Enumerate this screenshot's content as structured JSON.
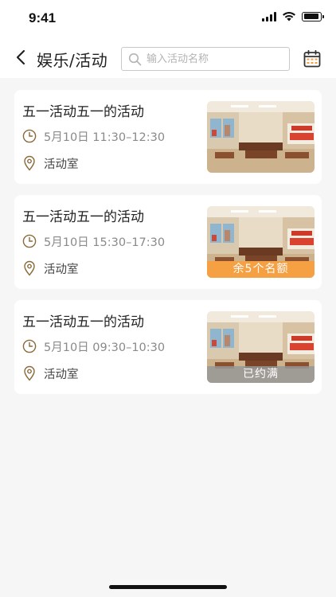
{
  "status_bar": {
    "time": "9:41"
  },
  "header": {
    "title": "娱乐/活动",
    "search_placeholder": "输入活动名称",
    "search_value": ""
  },
  "activities": [
    {
      "title": "五一活动五一的活动",
      "time": "5月10日 11:30–12:30",
      "location": "活动室",
      "badge": ""
    },
    {
      "title": "五一活动五一的活动",
      "time": "5月10日 15:30–17:30",
      "location": "活动室",
      "badge": "余5个名额"
    },
    {
      "title": "五一活动五一的活动",
      "time": "5月10日 09:30–10:30",
      "location": "活动室",
      "badge": "已约满"
    }
  ],
  "colors": {
    "accent": "#f6a044",
    "full_badge": "#969696",
    "background": "#f6f6f6"
  }
}
